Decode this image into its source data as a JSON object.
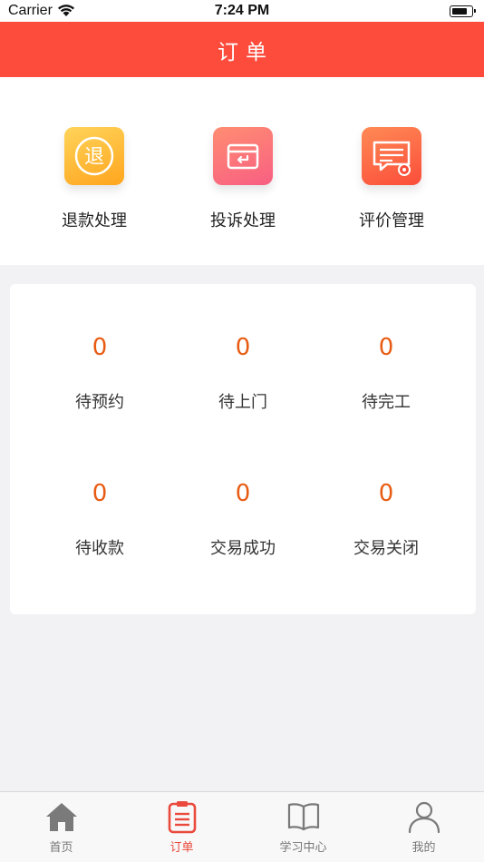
{
  "status_bar": {
    "carrier": "Carrier",
    "time": "7:24 PM"
  },
  "nav": {
    "title": "订单"
  },
  "shortcuts": [
    {
      "label": "退款处理",
      "icon": "refund-icon",
      "glyph": "退"
    },
    {
      "label": "投诉处理",
      "icon": "complaint-box-icon"
    },
    {
      "label": "评价管理",
      "icon": "review-management-icon"
    }
  ],
  "order_stats": [
    {
      "count": "0",
      "label": "待预约"
    },
    {
      "count": "0",
      "label": "待上门"
    },
    {
      "count": "0",
      "label": "待完工"
    },
    {
      "count": "0",
      "label": "待收款"
    },
    {
      "count": "0",
      "label": "交易成功"
    },
    {
      "count": "0",
      "label": "交易关闭"
    }
  ],
  "tabbar": [
    {
      "label": "首页",
      "icon": "home-icon",
      "active": false
    },
    {
      "label": "订单",
      "icon": "order-list-icon",
      "active": true
    },
    {
      "label": "学习中心",
      "icon": "book-icon",
      "active": false
    },
    {
      "label": "我的",
      "icon": "user-icon",
      "active": false
    }
  ],
  "colors": {
    "brand": "#fd4b3c",
    "count": "#e85b12",
    "tab_active": "#ea4a3d",
    "tab_inactive": "#777777"
  }
}
